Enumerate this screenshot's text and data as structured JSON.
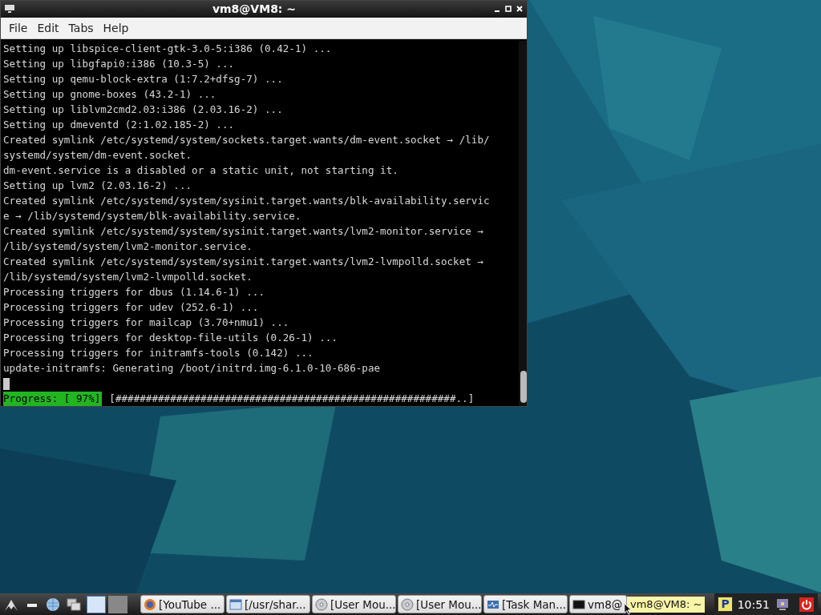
{
  "window": {
    "title": "vm8@VM8: ~",
    "menu": [
      "File",
      "Edit",
      "Tabs",
      "Help"
    ],
    "terminal_lines": [
      "Setting up libspice-client-gtk-3.0-5:i386 (0.42-1) ...",
      "Setting up libgfapi0:i386 (10.3-5) ...",
      "Setting up qemu-block-extra (1:7.2+dfsg-7) ...",
      "Setting up gnome-boxes (43.2-1) ...",
      "Setting up liblvm2cmd2.03:i386 (2.03.16-2) ...",
      "Setting up dmeventd (2:1.02.185-2) ...",
      "Created symlink /etc/systemd/system/sockets.target.wants/dm-event.socket → /lib/",
      "systemd/system/dm-event.socket.",
      "dm-event.service is a disabled or a static unit, not starting it.",
      "Setting up lvm2 (2.03.16-2) ...",
      "Created symlink /etc/systemd/system/sysinit.target.wants/blk-availability.servic",
      "e → /lib/systemd/system/blk-availability.service.",
      "Created symlink /etc/systemd/system/sysinit.target.wants/lvm2-monitor.service →",
      "/lib/systemd/system/lvm2-monitor.service.",
      "Created symlink /etc/systemd/system/sysinit.target.wants/lvm2-lvmpolld.socket →",
      "/lib/systemd/system/lvm2-lvmpolld.socket.",
      "Processing triggers for dbus (1.14.6-1) ...",
      "Processing triggers for udev (252.6-1) ...",
      "Processing triggers for mailcap (3.70+nmu1) ...",
      "Processing triggers for desktop-file-utils (0.26-1) ...",
      "Processing triggers for initramfs-tools (0.142) ...",
      "update-initramfs: Generating /boot/initrd.img-6.1.0-10-686-pae"
    ],
    "progress": {
      "label": "Progress: [ 97%]",
      "bar": "[########################################################..]"
    }
  },
  "taskbar": {
    "workspaces": [
      {
        "selected": true
      },
      {
        "selected": false
      }
    ],
    "tasks": [
      {
        "kind": "browser",
        "label": "[YouTube ..."
      },
      {
        "kind": "window",
        "label": "[/usr/shar..."
      },
      {
        "kind": "disc",
        "label": "[User Mou..."
      },
      {
        "kind": "disc",
        "label": "[User Mou..."
      },
      {
        "kind": "monitor",
        "label": "[Task Man..."
      },
      {
        "kind": "terminal",
        "label": "vm8@"
      }
    ],
    "tooltip": "vm8@VM8: ~",
    "tray_letter": "P",
    "clock": "10:51"
  }
}
